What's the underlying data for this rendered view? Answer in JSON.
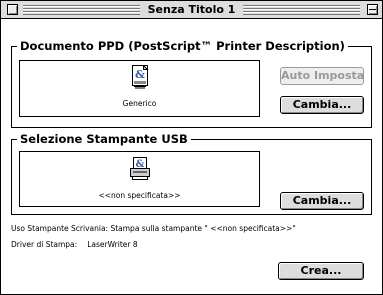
{
  "window": {
    "title": "Senza Titolo 1"
  },
  "ppd_section": {
    "title": "Documento PPD (PostScript™ Printer Description)",
    "icon": "ppd-document-icon",
    "icon_label": "Generico",
    "auto_button_label": "Auto Imposta",
    "auto_button_enabled": false,
    "change_button_label": "Cambia..."
  },
  "usb_section": {
    "title": "Selezione Stampante USB",
    "icon": "printer-document-icon",
    "icon_label": "<<non specificata>>",
    "change_button_label": "Cambia..."
  },
  "info": {
    "uso_text": "Uso Stampante Scrivania: Stampa sulla stampante \" <<non specificata>>\"",
    "driver_label": "Driver di Stampa:",
    "driver_value": "LaserWriter 8"
  },
  "footer": {
    "create_button_label": "Crea..."
  },
  "colors": {
    "titlebar": "#dddddd",
    "button_face": "#dddddd",
    "disabled_text": "#999999",
    "icon_accent": "#3355aa"
  }
}
